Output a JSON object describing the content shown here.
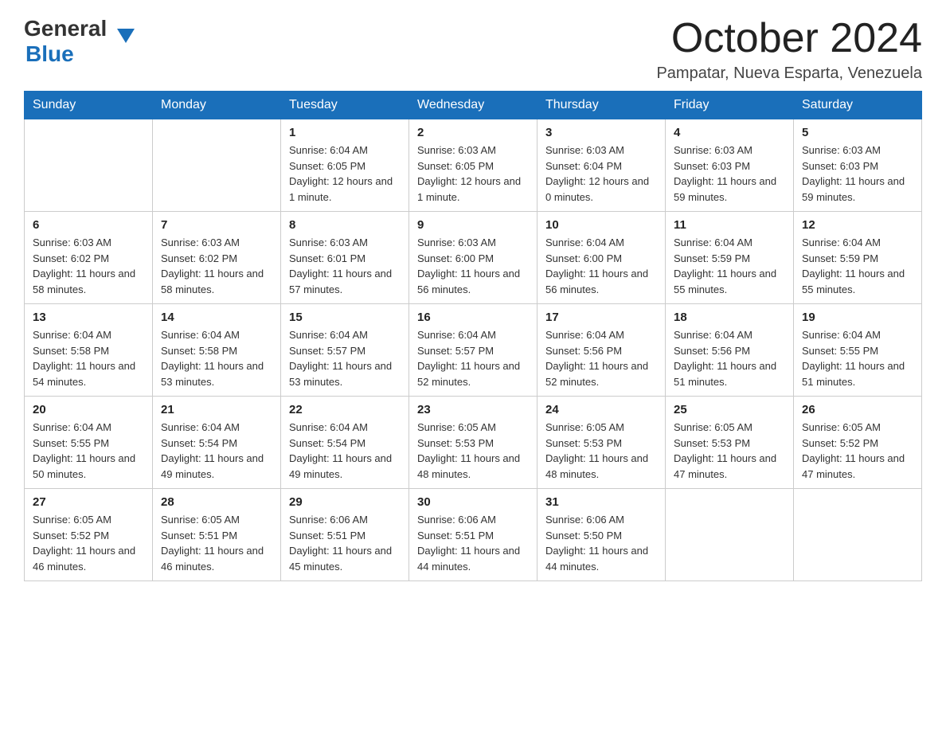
{
  "header": {
    "logo_general": "General",
    "logo_blue": "Blue",
    "month_title": "October 2024",
    "location": "Pampatar, Nueva Esparta, Venezuela"
  },
  "weekdays": [
    "Sunday",
    "Monday",
    "Tuesday",
    "Wednesday",
    "Thursday",
    "Friday",
    "Saturday"
  ],
  "weeks": [
    [
      {
        "day": "",
        "sunrise": "",
        "sunset": "",
        "daylight": ""
      },
      {
        "day": "",
        "sunrise": "",
        "sunset": "",
        "daylight": ""
      },
      {
        "day": "1",
        "sunrise": "Sunrise: 6:04 AM",
        "sunset": "Sunset: 6:05 PM",
        "daylight": "Daylight: 12 hours and 1 minute."
      },
      {
        "day": "2",
        "sunrise": "Sunrise: 6:03 AM",
        "sunset": "Sunset: 6:05 PM",
        "daylight": "Daylight: 12 hours and 1 minute."
      },
      {
        "day": "3",
        "sunrise": "Sunrise: 6:03 AM",
        "sunset": "Sunset: 6:04 PM",
        "daylight": "Daylight: 12 hours and 0 minutes."
      },
      {
        "day": "4",
        "sunrise": "Sunrise: 6:03 AM",
        "sunset": "Sunset: 6:03 PM",
        "daylight": "Daylight: 11 hours and 59 minutes."
      },
      {
        "day": "5",
        "sunrise": "Sunrise: 6:03 AM",
        "sunset": "Sunset: 6:03 PM",
        "daylight": "Daylight: 11 hours and 59 minutes."
      }
    ],
    [
      {
        "day": "6",
        "sunrise": "Sunrise: 6:03 AM",
        "sunset": "Sunset: 6:02 PM",
        "daylight": "Daylight: 11 hours and 58 minutes."
      },
      {
        "day": "7",
        "sunrise": "Sunrise: 6:03 AM",
        "sunset": "Sunset: 6:02 PM",
        "daylight": "Daylight: 11 hours and 58 minutes."
      },
      {
        "day": "8",
        "sunrise": "Sunrise: 6:03 AM",
        "sunset": "Sunset: 6:01 PM",
        "daylight": "Daylight: 11 hours and 57 minutes."
      },
      {
        "day": "9",
        "sunrise": "Sunrise: 6:03 AM",
        "sunset": "Sunset: 6:00 PM",
        "daylight": "Daylight: 11 hours and 56 minutes."
      },
      {
        "day": "10",
        "sunrise": "Sunrise: 6:04 AM",
        "sunset": "Sunset: 6:00 PM",
        "daylight": "Daylight: 11 hours and 56 minutes."
      },
      {
        "day": "11",
        "sunrise": "Sunrise: 6:04 AM",
        "sunset": "Sunset: 5:59 PM",
        "daylight": "Daylight: 11 hours and 55 minutes."
      },
      {
        "day": "12",
        "sunrise": "Sunrise: 6:04 AM",
        "sunset": "Sunset: 5:59 PM",
        "daylight": "Daylight: 11 hours and 55 minutes."
      }
    ],
    [
      {
        "day": "13",
        "sunrise": "Sunrise: 6:04 AM",
        "sunset": "Sunset: 5:58 PM",
        "daylight": "Daylight: 11 hours and 54 minutes."
      },
      {
        "day": "14",
        "sunrise": "Sunrise: 6:04 AM",
        "sunset": "Sunset: 5:58 PM",
        "daylight": "Daylight: 11 hours and 53 minutes."
      },
      {
        "day": "15",
        "sunrise": "Sunrise: 6:04 AM",
        "sunset": "Sunset: 5:57 PM",
        "daylight": "Daylight: 11 hours and 53 minutes."
      },
      {
        "day": "16",
        "sunrise": "Sunrise: 6:04 AM",
        "sunset": "Sunset: 5:57 PM",
        "daylight": "Daylight: 11 hours and 52 minutes."
      },
      {
        "day": "17",
        "sunrise": "Sunrise: 6:04 AM",
        "sunset": "Sunset: 5:56 PM",
        "daylight": "Daylight: 11 hours and 52 minutes."
      },
      {
        "day": "18",
        "sunrise": "Sunrise: 6:04 AM",
        "sunset": "Sunset: 5:56 PM",
        "daylight": "Daylight: 11 hours and 51 minutes."
      },
      {
        "day": "19",
        "sunrise": "Sunrise: 6:04 AM",
        "sunset": "Sunset: 5:55 PM",
        "daylight": "Daylight: 11 hours and 51 minutes."
      }
    ],
    [
      {
        "day": "20",
        "sunrise": "Sunrise: 6:04 AM",
        "sunset": "Sunset: 5:55 PM",
        "daylight": "Daylight: 11 hours and 50 minutes."
      },
      {
        "day": "21",
        "sunrise": "Sunrise: 6:04 AM",
        "sunset": "Sunset: 5:54 PM",
        "daylight": "Daylight: 11 hours and 49 minutes."
      },
      {
        "day": "22",
        "sunrise": "Sunrise: 6:04 AM",
        "sunset": "Sunset: 5:54 PM",
        "daylight": "Daylight: 11 hours and 49 minutes."
      },
      {
        "day": "23",
        "sunrise": "Sunrise: 6:05 AM",
        "sunset": "Sunset: 5:53 PM",
        "daylight": "Daylight: 11 hours and 48 minutes."
      },
      {
        "day": "24",
        "sunrise": "Sunrise: 6:05 AM",
        "sunset": "Sunset: 5:53 PM",
        "daylight": "Daylight: 11 hours and 48 minutes."
      },
      {
        "day": "25",
        "sunrise": "Sunrise: 6:05 AM",
        "sunset": "Sunset: 5:53 PM",
        "daylight": "Daylight: 11 hours and 47 minutes."
      },
      {
        "day": "26",
        "sunrise": "Sunrise: 6:05 AM",
        "sunset": "Sunset: 5:52 PM",
        "daylight": "Daylight: 11 hours and 47 minutes."
      }
    ],
    [
      {
        "day": "27",
        "sunrise": "Sunrise: 6:05 AM",
        "sunset": "Sunset: 5:52 PM",
        "daylight": "Daylight: 11 hours and 46 minutes."
      },
      {
        "day": "28",
        "sunrise": "Sunrise: 6:05 AM",
        "sunset": "Sunset: 5:51 PM",
        "daylight": "Daylight: 11 hours and 46 minutes."
      },
      {
        "day": "29",
        "sunrise": "Sunrise: 6:06 AM",
        "sunset": "Sunset: 5:51 PM",
        "daylight": "Daylight: 11 hours and 45 minutes."
      },
      {
        "day": "30",
        "sunrise": "Sunrise: 6:06 AM",
        "sunset": "Sunset: 5:51 PM",
        "daylight": "Daylight: 11 hours and 44 minutes."
      },
      {
        "day": "31",
        "sunrise": "Sunrise: 6:06 AM",
        "sunset": "Sunset: 5:50 PM",
        "daylight": "Daylight: 11 hours and 44 minutes."
      },
      {
        "day": "",
        "sunrise": "",
        "sunset": "",
        "daylight": ""
      },
      {
        "day": "",
        "sunrise": "",
        "sunset": "",
        "daylight": ""
      }
    ]
  ]
}
